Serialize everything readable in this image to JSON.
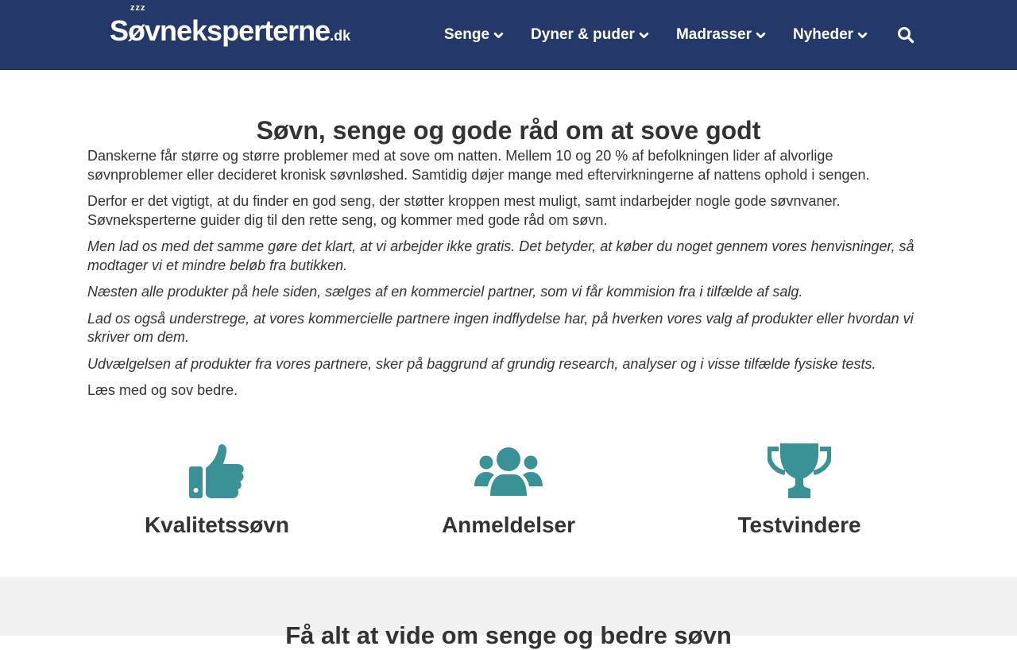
{
  "header": {
    "logo": {
      "sleep_mark": "zzz",
      "name": "Søvneksperterne",
      "tld": ".dk"
    },
    "nav": [
      {
        "label": "Senge"
      },
      {
        "label": "Dyner & puder"
      },
      {
        "label": "Madrasser"
      },
      {
        "label": "Nyheder"
      }
    ],
    "search_icon": "search-icon"
  },
  "main": {
    "title": "Søvn, senge og gode råd om at sove godt",
    "paragraphs": [
      "Danskerne får større og større problemer med at sove om natten. Mellem 10 og 20 % af befolkningen lider af alvorlige søvnproblemer eller decideret kronisk søvnløshed. Samtidig døjer mange med eftervirkningerne af nattens ophold i sengen.",
      "Derfor er det vigtigt, at du finder en god seng, der støtter kroppen mest muligt, samt indarbejder nogle gode søvnvaner. Søvneksperterne guider dig til den rette seng, og kommer med gode råd om søvn.",
      "Men lad os med det samme gøre det klart, at vi arbejder ikke gratis. Det betyder, at køber du noget gennem vores henvisninger, så modtager vi et mindre beløb fra butikken.",
      "Næsten alle produkter på hele siden, sælges af en kommerciel partner, som vi får kommision fra i tilfælde af salg.",
      "Lad os også understrege, at vores kommercielle partnere ingen indflydelse har, på hverken vores valg af produkter eller hvordan vi skriver om dem.",
      "Udvælgelsen af produkter fra vores partnere, sker på baggrund af grundig research, analyser og i visse tilfælde fysiske tests.",
      "Læs med og sov bedre."
    ]
  },
  "features": [
    {
      "label": "Kvalitetssøvn",
      "icon": "thumbs-up-icon"
    },
    {
      "label": "Anmeldelser",
      "icon": "users-icon"
    },
    {
      "label": "Testvindere",
      "icon": "trophy-icon"
    }
  ],
  "bottom": {
    "title": "Få alt at vide om senge og bedre søvn"
  },
  "colors": {
    "header_bg": "#24386a",
    "accent_teal": "#3a9196",
    "text": "#333333",
    "band_bg": "#f1f1f1"
  }
}
